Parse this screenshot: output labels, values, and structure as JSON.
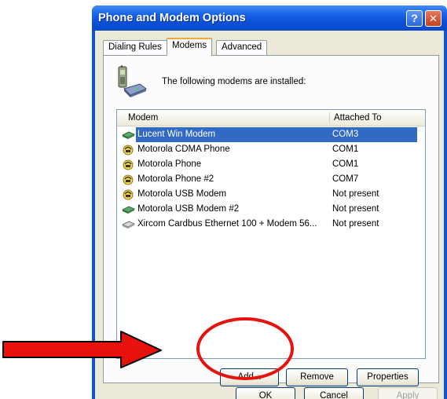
{
  "window": {
    "title": "Phone and Modem Options"
  },
  "tabs": [
    {
      "label": "Dialing Rules"
    },
    {
      "label": "Modems"
    },
    {
      "label": "Advanced"
    }
  ],
  "panel": {
    "info_text": "The following modems are  installed:"
  },
  "list": {
    "columns": [
      "Modem",
      "Attached To"
    ],
    "rows": [
      {
        "name": "Lucent Win Modem",
        "port": "COM3",
        "icon": "modem-green-icon",
        "selected": true
      },
      {
        "name": "Motorola CDMA Phone",
        "port": "COM1",
        "icon": "modem-yellow-icon"
      },
      {
        "name": "Motorola Phone",
        "port": "COM1",
        "icon": "modem-yellow-icon"
      },
      {
        "name": "Motorola Phone #2",
        "port": "COM7",
        "icon": "modem-yellow-icon"
      },
      {
        "name": "Motorola USB Modem",
        "port": "Not present",
        "icon": "modem-yellow-icon"
      },
      {
        "name": "Motorola USB Modem #2",
        "port": "Not present",
        "icon": "modem-green-icon"
      },
      {
        "name": "Xircom Cardbus Ethernet 100 + Modem 56...",
        "port": "Not present",
        "icon": "modem-gray-icon"
      }
    ]
  },
  "buttons": {
    "add": "Add...",
    "remove": "Remove",
    "properties": "Properties",
    "ok": "OK",
    "cancel": "Cancel",
    "apply": "Apply"
  },
  "annotation": {
    "arrow_color": "#e8120c",
    "circle_color": "#e8120c"
  },
  "colors": {
    "title_bar": "#0b4fd6",
    "selection": "#316ac5",
    "dialog_face": "#ece9d8"
  }
}
